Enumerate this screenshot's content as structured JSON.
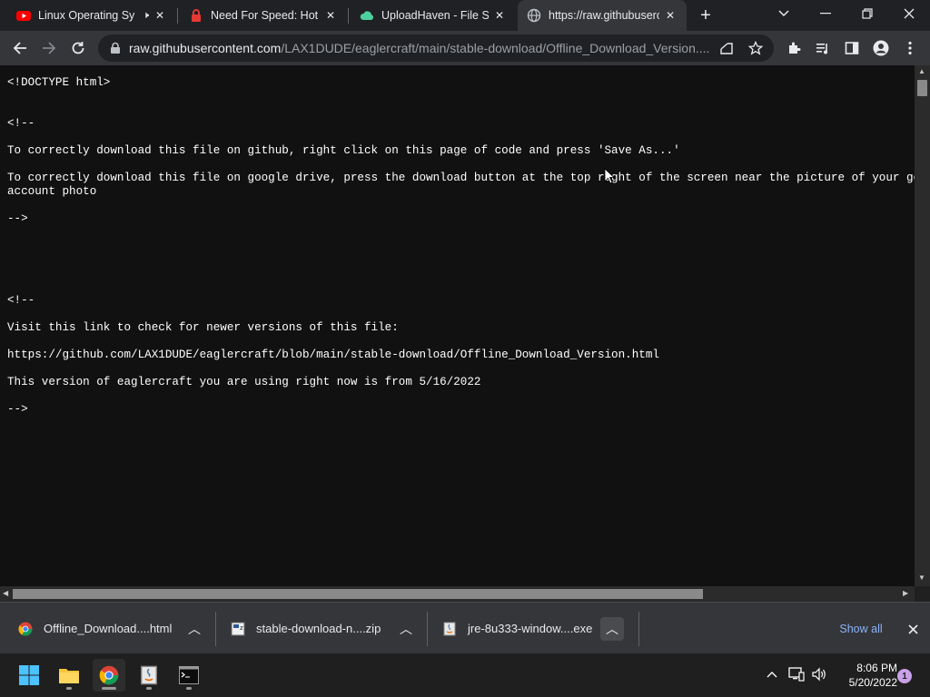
{
  "browser": {
    "tabs": [
      {
        "title": "Linux Operating Sy",
        "favicon": "youtube-icon",
        "audio": true
      },
      {
        "title": "Need For Speed: Hot P",
        "favicon": "lock-red-icon"
      },
      {
        "title": "UploadHaven - File Sha",
        "favicon": "cloud-icon"
      },
      {
        "title": "https://raw.githubuserc",
        "favicon": "globe-icon",
        "active": true
      }
    ],
    "new_tab_label": "+",
    "address_host": "raw.githubusercontent.com",
    "address_path": "/LAX1DUDE/eaglercraft/main/stable-download/Offline_Download_Version...."
  },
  "content": {
    "lines": [
      "<!DOCTYPE html>",
      "<!--",
      "To correctly download this file on github, right click on this page of code and press 'Save As...'",
      "To correctly download this file on google drive, press the download button at the top right of the screen near the picture of your google",
      "account photo",
      "-->",
      "<!--",
      "Visit this link to check for newer versions of this file:",
      "https://github.com/LAX1DUDE/eaglercraft/blob/main/stable-download/Offline_Download_Version.html",
      "This version of eaglercraft you are using right now is from 5/16/2022",
      "-->"
    ]
  },
  "downloads": {
    "items": [
      {
        "name": "Offline_Download....html",
        "icon": "chrome-file-icon"
      },
      {
        "name": "stable-download-n....zip",
        "icon": "zip-file-icon"
      },
      {
        "name": "jre-8u333-window....exe",
        "icon": "java-installer-icon"
      }
    ],
    "show_all": "Show all"
  },
  "taskbar": {
    "time": "8:06 PM",
    "date": "5/20/2022",
    "notification_count": "1"
  },
  "colors": {
    "chrome_dark": "#202124",
    "toolbar": "#35363a",
    "page_bg": "#111111",
    "link_blue": "#8ab4f8"
  }
}
